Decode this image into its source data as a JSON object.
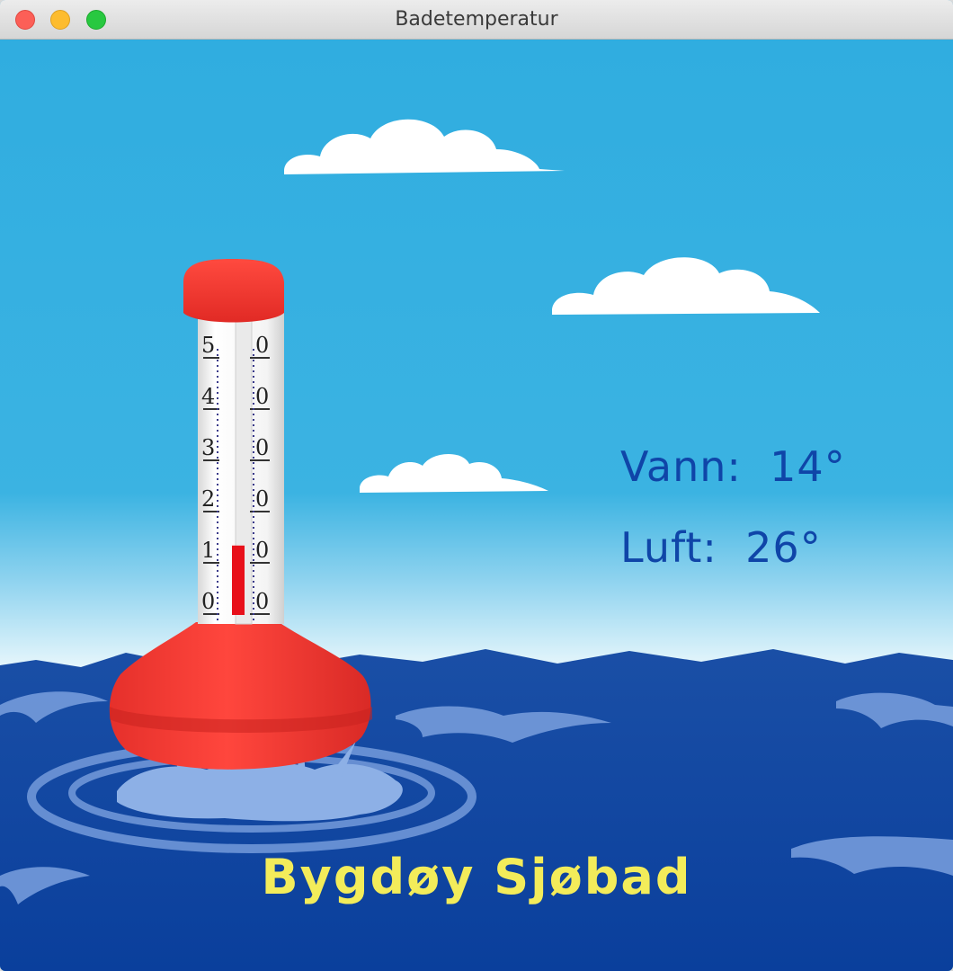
{
  "window": {
    "title": "Badetemperatur"
  },
  "readings": {
    "water_label": "Vann:",
    "water_value": "14°",
    "air_label": "Luft:",
    "air_value": "26°"
  },
  "location": "Bygdøy Sjøbad",
  "thermometer": {
    "left_scale": [
      "5",
      "4",
      "3",
      "2",
      "1",
      "0"
    ],
    "right_scale": [
      "0",
      "0",
      "0",
      "0",
      "0",
      "0"
    ],
    "level_fraction": 0.27
  },
  "colors": {
    "sky": "#34b0df",
    "sea": "#0c45a3",
    "buoy": "#f23a34",
    "text_readings": "#0f45a8",
    "text_location": "#f3ec5a",
    "mercury": "#e8101a"
  }
}
